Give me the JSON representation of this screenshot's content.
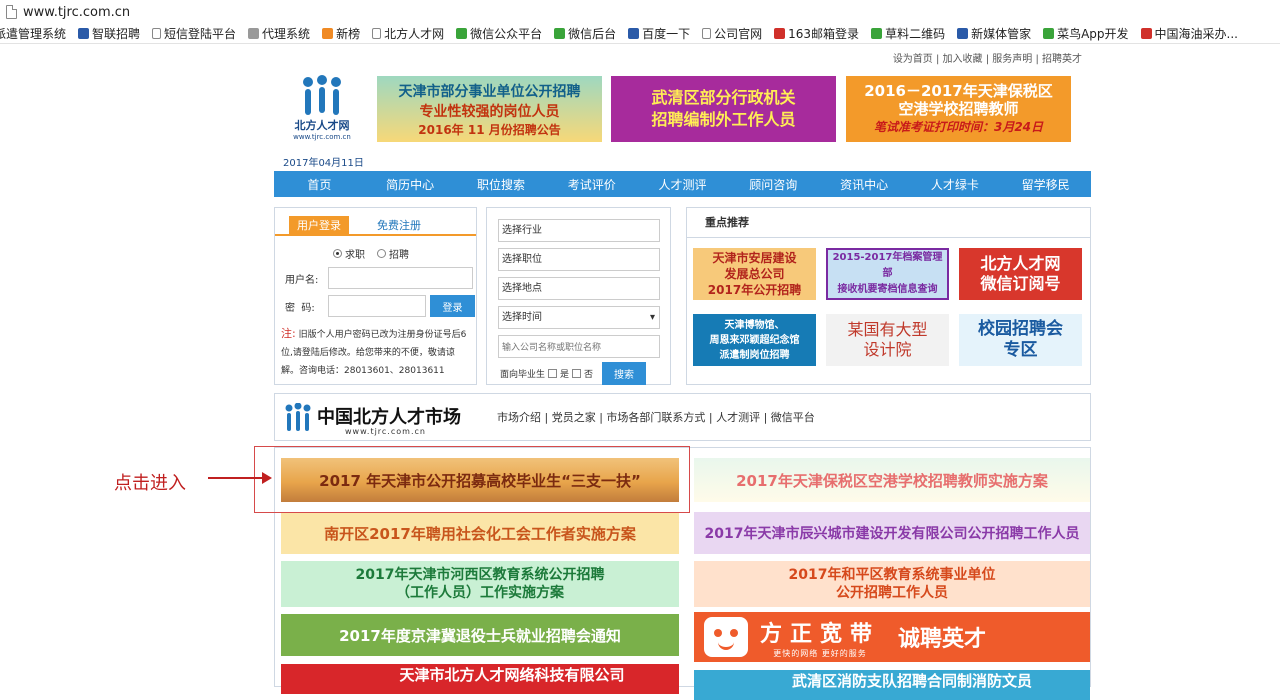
{
  "browser": {
    "url": "www.tjrc.com.cn"
  },
  "bookmarks": [
    {
      "label": "派遣管理系统",
      "icon": "folder-icon",
      "color": "#ffffff"
    },
    {
      "label": "智联招聘",
      "icon": "globe-icon",
      "color": "#2a5aa8"
    },
    {
      "label": "短信登陆平台",
      "icon": "page-icon",
      "color": "#ffffff"
    },
    {
      "label": "代理系统",
      "icon": "loader-icon",
      "color": "#999999"
    },
    {
      "label": "新榜",
      "icon": "bang-icon",
      "color": "#f08a24"
    },
    {
      "label": "北方人才网",
      "icon": "page-icon",
      "color": "#ffffff"
    },
    {
      "label": "微信公众平台",
      "icon": "wechat-icon",
      "color": "#3aa43a"
    },
    {
      "label": "微信后台",
      "icon": "cloud-icon",
      "color": "#3aa43a"
    },
    {
      "label": "百度一下",
      "icon": "baidu-icon",
      "color": "#2a5aa8"
    },
    {
      "label": "公司官网",
      "icon": "page-icon",
      "color": "#ffffff"
    },
    {
      "label": "163邮箱登录",
      "icon": "mail163-icon",
      "color": "#d0302a"
    },
    {
      "label": "草料二维码",
      "icon": "qrcode-icon",
      "color": "#3aa43a"
    },
    {
      "label": "新媒体管家",
      "icon": "media-icon",
      "color": "#2a5aa8"
    },
    {
      "label": "菜鸟App开发",
      "icon": "bird-icon",
      "color": "#3aa43a"
    },
    {
      "label": "中国海油采办...",
      "icon": "oil-icon",
      "color": "#d0302a"
    }
  ],
  "header": {
    "top_links": "设为首页 | 加入收藏 | 服务声明 | 招聘英才",
    "logo_text": "北方人才网",
    "logo_url": "www.tjrc.com.cn",
    "date": "2017年04月11日"
  },
  "banners": [
    {
      "line1": "天津市部分事业单位公开招聘",
      "line2": "专业性较强的岗位人员",
      "line3": "2016年 11 月份招聘公告"
    },
    {
      "line1": "武清区部分行政机关",
      "line2": "招聘编制外工作人员"
    },
    {
      "line1": "2016－2017年天津保税区",
      "line2": "空港学校招聘教师",
      "line3": "笔试准考证打印时间：3月24日"
    }
  ],
  "nav": [
    "首页",
    "简历中心",
    "职位搜索",
    "考试评价",
    "人才测评",
    "顾问咨询",
    "资讯中心",
    "人才绿卡",
    "留学移民"
  ],
  "login": {
    "tab_active": "用户登录",
    "tab_inactive": "免费注册",
    "radio_seeker": "求职",
    "radio_recruiter": "招聘",
    "username_label": "用户名:",
    "password_label": "密  码:",
    "login_button": "登录",
    "note_prefix": "注:",
    "note_text": " 旧版个人用户密码已改为注册身份证号后6位,请登陆后修改。给您带来的不便，敬请谅解。咨询电话：28013601、28013611"
  },
  "search": {
    "industry": "选择行业",
    "position": "选择职位",
    "location": "选择地点",
    "time": "选择时间",
    "keyword_placeholder": "输入公司名称或职位名称",
    "graduate_label": "面向毕业生",
    "yes_label": "是",
    "no_label": "否",
    "search_button": "搜索"
  },
  "featured": {
    "title": "重点推荐",
    "items": [
      {
        "line1": "天津市安居建设",
        "line2": "发展总公司",
        "line3": "2017年公开招聘"
      },
      {
        "line1": "2015-2017年档案管理部",
        "line2": "接收机要寄档信息查询"
      },
      {
        "line1": "北方人才网",
        "line2": "微信订阅号"
      },
      {
        "line1": "天津博物馆、",
        "line2": "周恩来邓颖超纪念馆",
        "line3": "派遣制岗位招聘"
      },
      {
        "line1": "某国有大型",
        "line2": "设计院"
      },
      {
        "line1": "校园招聘会",
        "line2": "专区"
      }
    ]
  },
  "market": {
    "title": "中国北方人才市场",
    "url": "www.tjrc.com.cn",
    "links": "市场介绍 | 党员之家 | 市场各部门联系方式 | 人才测评 | 微信平台"
  },
  "announcements": {
    "a1": "2017 年天津市公开招募高校毕业生“三支一扶”",
    "a2": "2017年天津保税区空港学校招聘教师实施方案",
    "a3": "南开区2017年聘用社会化工会工作者实施方案",
    "a4": "2017年天津市辰兴城市建设开发有限公司公开招聘工作人员",
    "a5_line1": "2017年天津市河西区教育系统公开招聘",
    "a5_line2": "（工作人员）工作实施方案",
    "a6_line1": "2017年和平区教育系统事业单位",
    "a6_line2": "公开招聘工作人员",
    "a7": "2017年度京津冀退役士兵就业招聘会通知",
    "a8_big": "方正宽带",
    "a8_small": "更快的网络  更好的服务",
    "a8_right": "诚聘英才",
    "a9": "天津市北方人才网络科技有限公司",
    "a10": "武清区消防支队招聘合同制消防文员"
  },
  "annotation": {
    "text": "点击进入"
  }
}
